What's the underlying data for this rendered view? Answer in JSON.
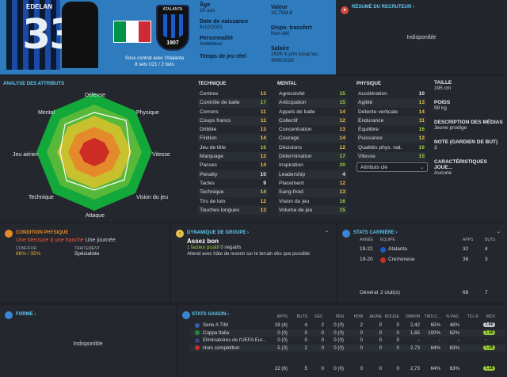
{
  "header": {
    "player_name": "EDELAN",
    "shirt_number": "33",
    "contract_line1": "Sous contrat avec l'Atalanta",
    "contract_line2": "8 sels U21 / 2 buts",
    "crest_top": "ATALANTA",
    "crest_year": "1907",
    "age_label": "Âge",
    "age_value": "20 ans",
    "dob_label": "Date de naissance",
    "dob_value": "6/10/2001",
    "personality_label": "Personnalité",
    "personality_value": "Ambitieux",
    "playtime_label": "Temps de jeu réel",
    "playtime_value": "",
    "value_label": "Valeur",
    "value_value": "10,75M €",
    "transfer_label": "Dispo. transfert",
    "transfer_value": "Non déf.",
    "salary_label": "Salaire",
    "salary_value1": "192K € p/m jusqu'au",
    "salary_value2": "30/6/2026",
    "flag_colors": [
      "#009246",
      "#ffffff",
      "#ce2b37"
    ]
  },
  "scout": {
    "title": "RÉSUMÉ DU RECRUTEUR ›",
    "unavailable": "Indisponible",
    "icon": "scout-icon"
  },
  "attributes": {
    "title": "ANALYSE DES ATTRIBUTS",
    "radar_labels": [
      "Défense",
      "Physique",
      "Vitesse",
      "Vision du jeu",
      "Attaque",
      "Technique",
      "Jeu aérien",
      "Mental"
    ],
    "technique": {
      "header": "TECHNIQUE",
      "rows": [
        [
          "Centres",
          "13"
        ],
        [
          "Contrôle de balle",
          "17"
        ],
        [
          "Corners",
          "11"
        ],
        [
          "Coups francs",
          "11"
        ],
        [
          "Dribble",
          "13"
        ],
        [
          "Finition",
          "14"
        ],
        [
          "Jeu de tête",
          "16"
        ],
        [
          "Marquage",
          "12"
        ],
        [
          "Passes",
          "14"
        ],
        [
          "Penalty",
          "10"
        ],
        [
          "Tacles",
          "9"
        ],
        [
          "Technique",
          "14"
        ],
        [
          "Tirs de loin",
          "12"
        ],
        [
          "Touches longues",
          "13"
        ]
      ]
    },
    "mental": {
      "header": "MENTAL",
      "rows": [
        [
          "Agressivité",
          "15"
        ],
        [
          "Anticipation",
          "15"
        ],
        [
          "Appels de balle",
          "14"
        ],
        [
          "Collectif",
          "12"
        ],
        [
          "Concentration",
          "13"
        ],
        [
          "Courage",
          "14"
        ],
        [
          "Décisions",
          "12"
        ],
        [
          "Détermination",
          "17"
        ],
        [
          "Inspiration",
          "20"
        ],
        [
          "Leadership",
          "4"
        ],
        [
          "Placement",
          "12"
        ],
        [
          "Sang-froid",
          "13"
        ],
        [
          "Vision du jeu",
          "16"
        ],
        [
          "Volume de jeu",
          "15"
        ]
      ]
    },
    "physique": {
      "header": "PHYSIQUE",
      "rows": [
        [
          "Accélération",
          "10"
        ],
        [
          "Agilité",
          "13"
        ],
        [
          "Détente verticale",
          "14"
        ],
        [
          "Endurance",
          "11"
        ],
        [
          "Équilibre",
          "16"
        ],
        [
          "Puissance",
          "12"
        ],
        [
          "Qualités phys. nat.",
          "16"
        ],
        [
          "Vitesse",
          "15"
        ]
      ]
    },
    "dropdown_label": "Attributs clé",
    "side": [
      {
        "label": "TAILLE",
        "value": "195 cm"
      },
      {
        "label": "POIDS",
        "value": "98 kg"
      },
      {
        "label": "DESCRIPTION DES MÉDIAS",
        "value": "Jeune prodige"
      },
      {
        "label": "NOTE (GARDIEN DE BUT)",
        "value": "3"
      },
      {
        "label": "CARACTÉRISTIQUES JOUE...",
        "value": "Aucune"
      }
    ]
  },
  "condition": {
    "title": "CONDITION PHYSIQUE",
    "injury": "Une blessure à une hanche",
    "injury_time": "Une journée",
    "confidence_label": "CONF/FOR",
    "confidence_value": "88% / 35%",
    "confidence_color": "#f0b030",
    "treatment_label": "TRAITEMENT",
    "treatment_value": "Spécialiste"
  },
  "dynamics": {
    "title": "DYNAMIQUE DE GROUPE ›",
    "status": "Assez bon",
    "positive": "1 facteur positif",
    "negative": "0 négatifs",
    "note": "Attend avec hâte de revenir sur le terrain dès que possible"
  },
  "career": {
    "title": "STATS CARRIÈRE ›",
    "col_year": "ANNÉE",
    "col_team": "ÉQUIPE",
    "col_apps": "APPS",
    "col_goals": "BUTS",
    "rows": [
      {
        "year": "19-22",
        "team": "Atalanta",
        "apps": "32",
        "goals": "4"
      },
      {
        "year": "19-20",
        "team": "Cremonese",
        "apps": "36",
        "goals": "3"
      }
    ],
    "total_label": "Général",
    "total_clubs": "2 club(s)",
    "total_apps": "68",
    "total_goals": "7"
  },
  "form": {
    "title": "FORME ›",
    "unavailable": "Indisponible"
  },
  "season": {
    "title": "STATS SAISON ›",
    "headers": [
      "APPS",
      "BUTS",
      "DÉC.",
      "PEN",
      "HDM",
      "JAUNE",
      "ROUGE",
      "DRBPM",
      "TIRS C...",
      "% PAS.",
      "TCL R",
      "MOY."
    ],
    "rows": [
      {
        "comp": "Serie A TIM",
        "vals": [
          "18 (4)",
          "4",
          "2",
          "0 (0)",
          "2",
          "0",
          "0",
          "2,42",
          "65%",
          "48%"
        ],
        "rating": "7,00",
        "rating_color": "#cfd3d8"
      },
      {
        "comp": "Coppa Italia",
        "vals": [
          "0 (0)",
          "0",
          "0",
          "0 (0)",
          "0",
          "0",
          "0",
          "1,65",
          "100%",
          "62%"
        ],
        "rating": "7,10",
        "rating_color": "#9ed23c"
      },
      {
        "comp": "Éliminatoires de l'UEFA Eur...",
        "vals": [
          "0 (0)",
          "0",
          "0",
          "0 (0)",
          "0",
          "0",
          "0",
          "-",
          "-",
          "-"
        ],
        "rating": "-",
        "rating_color": ""
      },
      {
        "comp": "Hors compétition",
        "vals": [
          "5 (3)",
          "2",
          "0",
          "0 (0)",
          "0",
          "0",
          "0",
          "2,73",
          "64%",
          "63%"
        ],
        "rating": "7,25",
        "rating_color": "#9ed23c"
      }
    ],
    "total": {
      "vals": [
        "22 (6)",
        "5",
        "0",
        "0 (0)",
        "0",
        "0",
        "0",
        "2,73",
        "64%",
        "63%"
      ],
      "rating": "7,15",
      "rating_color": "#9ed23c"
    }
  }
}
